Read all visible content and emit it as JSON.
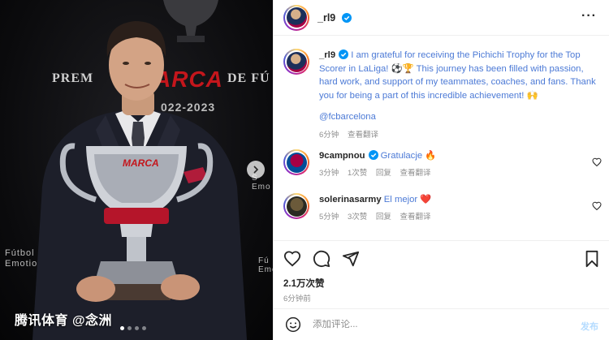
{
  "media": {
    "backdrop": {
      "premios": "PREM",
      "marca": "ARCA",
      "de_futbol": "DE FÚ",
      "year": "022-2023",
      "side_left": "Fútbol\nEmotio",
      "side_right": "S\nEmo",
      "side_right2": "Fú\nEmo"
    },
    "trophy_label": "MARCA",
    "watermark": "腾讯体育 @念洲",
    "carousel_dots": 4,
    "carousel_active": 0
  },
  "header": {
    "username": "_rl9",
    "more_label": "···"
  },
  "caption": {
    "username": "_rl9",
    "text": "I am grateful for receiving the Pichichi Trophy for the Top Scorer in LaLiga! ⚽🏆 This journey has been filled with passion, hard work, and support of my teammates, coaches, and fans. Thank you for being a part of this incredible achievement! 🙌",
    "mention": "@fcbarcelona",
    "time": "6分钟",
    "translate": "查看翻译"
  },
  "comments": [
    {
      "username": "9campnou",
      "text": "Gratulacje 🔥",
      "verified": true,
      "time": "3分钟",
      "likes": "1次赞",
      "reply": "回复",
      "translate": "查看翻译"
    },
    {
      "username": "solerinasarmy",
      "text": "El mejor ❤️",
      "verified": false,
      "time": "5分钟",
      "likes": "3次赞",
      "reply": "回复",
      "translate": "查看翻译"
    }
  ],
  "actions": {
    "icons": [
      "heart-icon",
      "comment-icon",
      "share-icon",
      "bookmark-icon"
    ],
    "likes_count": "2.1万次赞",
    "time_ago": "6分钟前"
  },
  "add_comment": {
    "placeholder": "添加评论...",
    "post_label": "发布"
  },
  "colors": {
    "verified": "#0095f6",
    "link": "#4c7ad6",
    "muted": "#8e8e8e",
    "post_disabled": "#b3dbff"
  }
}
